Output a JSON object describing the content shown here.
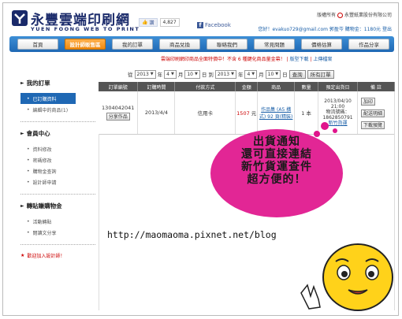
{
  "brand": {
    "name_cn": "永豐雲端印刷網",
    "name_en": "YUEN FOONG WEB TO PRINT",
    "color": "#1a2a6a"
  },
  "facebook": {
    "like_label": "讚",
    "like_count": "4,827",
    "link_label": "Facebook"
  },
  "top_right": {
    "copyright": "版權所有",
    "company": "永豐紙業股份有限公司",
    "user_line": "您好！evakuo729@gmail.com  郭盈岑  購物金：1180元",
    "logout": "登出"
  },
  "nav": {
    "items": [
      {
        "label": "首頁"
      },
      {
        "label": "設計師販售區",
        "active": true
      },
      {
        "label": "我的訂單"
      },
      {
        "label": "商品兌換"
      },
      {
        "label": "聯絡我們"
      },
      {
        "label": "常見問題"
      },
      {
        "label": "價格估算"
      },
      {
        "label": "作品分享"
      }
    ]
  },
  "sub_nav": {
    "notice": "雲端印刷網印商品全面特價中！不含 6 種鍵化商品量金幕！",
    "links": [
      "版型下載",
      "上傳檔案"
    ]
  },
  "filter": {
    "from_label": "從",
    "from_year": "2013",
    "from_month": "4",
    "from_day": "10",
    "to_label": "到",
    "to_year": "2013",
    "to_month": "4",
    "to_day": "10",
    "year_unit": "年",
    "month_unit": "月",
    "day_unit": "日",
    "query_button": "查詢",
    "all_button": "所有訂單"
  },
  "sidebar": {
    "sections": [
      {
        "title": "我的訂單",
        "items": [
          {
            "label": "已訂購資料",
            "active": true
          },
          {
            "label": "編輯中的商品(1)"
          }
        ]
      },
      {
        "title": "會員中心",
        "items": [
          {
            "label": "資料修改"
          },
          {
            "label": "密碼修改"
          },
          {
            "label": "購物金查詢"
          },
          {
            "label": "設計師申請"
          }
        ]
      },
      {
        "title": "轉貼賺購物金",
        "items": [
          {
            "label": "活動轉貼"
          },
          {
            "label": "閱讀文分享"
          }
        ]
      }
    ],
    "promo": "歡迎加入設計師！"
  },
  "table": {
    "headers": [
      "訂單編號",
      "訂購時間",
      "付款方式",
      "金額",
      "商品",
      "數量",
      "預定出貨日",
      "備 註"
    ],
    "row": {
      "order_no": "1304042041",
      "share_button": "分享作品",
      "date": "2013/4/4",
      "payment": "信用卡",
      "amount": "1507",
      "amount_unit": "元",
      "product": "作品集 (A5 橫式) 92 頁(精裝)",
      "qty": "1 本",
      "ship_date": "2013/04/10",
      "ship_time": "21:00",
      "tracking_label": "物流號碼：",
      "tracking_no": "1862850791",
      "tracking_link": "新竹貨運",
      "actions": [
        "加印",
        "配送明細",
        "下載預覽"
      ]
    }
  },
  "overlay": {
    "bubble_lines": [
      "出貨通知",
      "還可直接連結",
      "新竹貨運查件",
      "超方便的！"
    ],
    "bubble_color": "#e0148c",
    "blog_url": "http://maomaoma.pixnet.net/blog"
  }
}
